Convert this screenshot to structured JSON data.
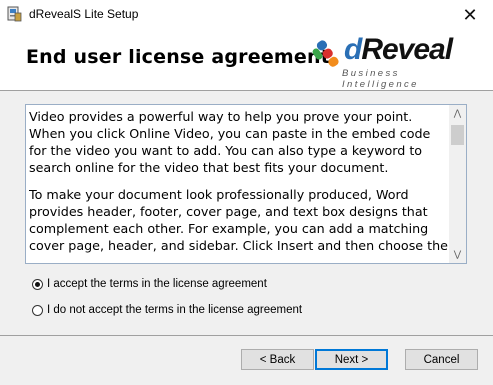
{
  "window": {
    "title": "dRevealS Lite Setup",
    "close_symbol": "✕"
  },
  "banner": {
    "title": "End user license agreement",
    "logo": {
      "brand_prefix": "d",
      "brand_name": "Reveal",
      "tagline": "Business Intelligence"
    }
  },
  "license": {
    "paragraphs": [
      "Video provides a powerful way to help you prove your point. When you click Online Video, you can paste in the embed code for the video you want to add. You can also type a keyword to search online for the video that best fits your document.",
      "To make your document look professionally produced, Word provides header, footer, cover page, and text box designs that complement each other. For example, you can add a matching cover page, header, and sidebar. Click Insert and then choose the"
    ],
    "scroll_up_symbol": "⋀",
    "scroll_down_symbol": "⋁"
  },
  "options": {
    "accept_label": "I accept the terms in the license agreement",
    "decline_label": "I do not accept the terms in the license agreement",
    "selected": "accept"
  },
  "buttons": {
    "back_label": "< Back",
    "next_label": "Next >",
    "cancel_label": "Cancel"
  },
  "colors": {
    "accent": "#0078d7",
    "logo_blue": "#2a6fb5",
    "logo_red": "#d9302c",
    "logo_orange": "#f28c1c",
    "logo_green": "#3aa64a"
  }
}
